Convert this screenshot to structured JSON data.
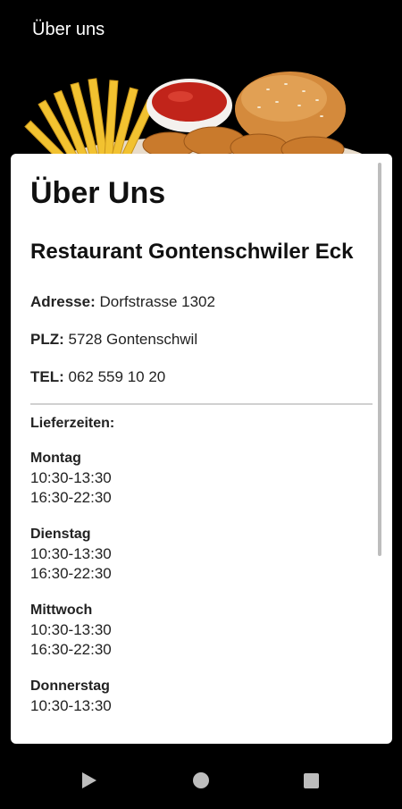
{
  "appbar": {
    "title": "Über uns"
  },
  "card": {
    "heading": "Über Uns",
    "restaurant_name": "Restaurant Gontenschwiler Eck",
    "address": {
      "label": "Adresse:",
      "value": "Dorfstrasse 1302"
    },
    "plz": {
      "label": "PLZ:",
      "value": "5728 Gontenschwil"
    },
    "tel": {
      "label": "TEL:",
      "value": "062 559 10 20"
    },
    "delivery_title": "Lieferzeiten:",
    "days": [
      {
        "name": "Montag",
        "slots": [
          "10:30-13:30",
          "16:30-22:30"
        ]
      },
      {
        "name": "Dienstag",
        "slots": [
          "10:30-13:30",
          "16:30-22:30"
        ]
      },
      {
        "name": "Mittwoch",
        "slots": [
          "10:30-13:30",
          "16:30-22:30"
        ]
      },
      {
        "name": "Donnerstag",
        "slots": [
          "10:30-13:30"
        ]
      }
    ]
  },
  "icons": {
    "hero": "food-image",
    "nav_back": "back-triangle-icon",
    "nav_home": "home-circle-icon",
    "nav_recents": "recents-square-icon"
  },
  "colors": {
    "background": "#000000",
    "card": "#ffffff",
    "text": "#111111"
  }
}
